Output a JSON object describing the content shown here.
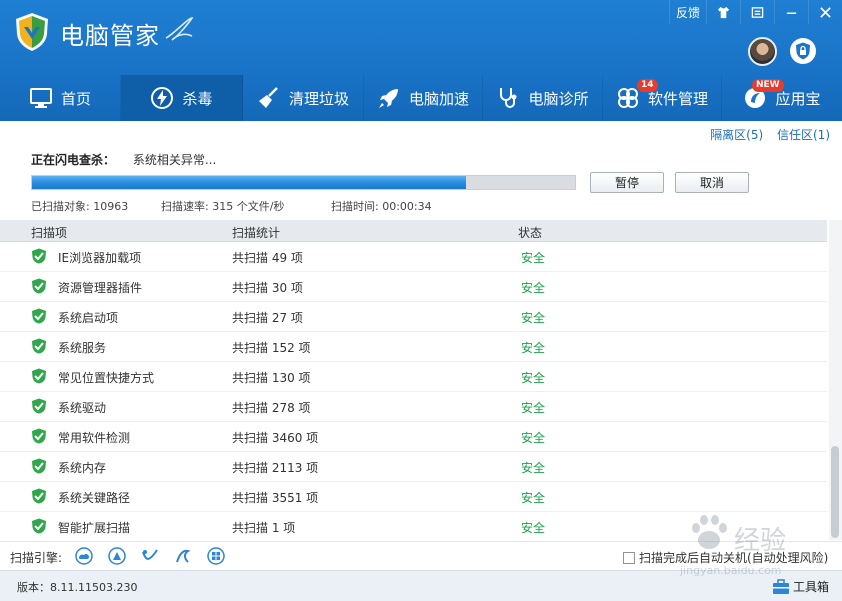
{
  "app": {
    "title": "电脑管家"
  },
  "window_buttons": {
    "feedback": "反馈"
  },
  "nav": [
    {
      "label": "首页",
      "icon": "monitor-icon"
    },
    {
      "label": "杀毒",
      "icon": "antivirus-icon",
      "active": true
    },
    {
      "label": "清理垃圾",
      "icon": "broom-icon"
    },
    {
      "label": "电脑加速",
      "icon": "rocket-icon"
    },
    {
      "label": "电脑诊所",
      "icon": "stethoscope-icon"
    },
    {
      "label": "软件管理",
      "icon": "software-icon",
      "badge": "14"
    },
    {
      "label": "应用宝",
      "icon": "app-store-icon",
      "badge": "NEW"
    }
  ],
  "quarantine": {
    "isolation": "隔离区(5)",
    "trust": "信任区(1)"
  },
  "scan": {
    "status_label": "正在闪电查杀：",
    "status_text": "系统相关异常...",
    "progress_percent": 80,
    "pause_label": "暂停",
    "cancel_label": "取消",
    "scanned_objects": "已扫描对象: 10963",
    "scan_speed": "扫描速率: 315 个文件/秒",
    "scan_time": "扫描时间: 00:00:34"
  },
  "table": {
    "headers": {
      "item": "扫描项",
      "stats": "扫描统计",
      "status": "状态"
    },
    "rows": [
      {
        "name": "IE浏览器加载项",
        "count": "共扫描 49 项",
        "status": "安全"
      },
      {
        "name": "资源管理器插件",
        "count": "共扫描 30 项",
        "status": "安全"
      },
      {
        "name": "系统启动项",
        "count": "共扫描 27 项",
        "status": "安全"
      },
      {
        "name": "系统服务",
        "count": "共扫描 152 项",
        "status": "安全"
      },
      {
        "name": "常见位置快捷方式",
        "count": "共扫描 130 项",
        "status": "安全"
      },
      {
        "name": "系统驱动",
        "count": "共扫描 278 项",
        "status": "安全"
      },
      {
        "name": "常用软件检测",
        "count": "共扫描 3460 项",
        "status": "安全"
      },
      {
        "name": "系统内存",
        "count": "共扫描 2113 项",
        "status": "安全"
      },
      {
        "name": "系统关键路径",
        "count": "共扫描 3551 项",
        "status": "安全"
      },
      {
        "name": "智能扩展扫描",
        "count": "共扫描 1 项",
        "status": "安全"
      }
    ]
  },
  "engine": {
    "label": "扫描引擎:",
    "auto_shutdown": "扫描完成后自动关机(自动处理风险)"
  },
  "footer": {
    "version": "版本：8.11.11503.230",
    "toolbox": "工具箱"
  },
  "watermark": {
    "text": "经验",
    "url": "jingyan.baidu.com"
  },
  "colors": {
    "header_blue": "#1a74c8",
    "active_tab": "#0f5ea8",
    "safe_green": "#19a34a",
    "link_blue": "#1d6fb8"
  }
}
